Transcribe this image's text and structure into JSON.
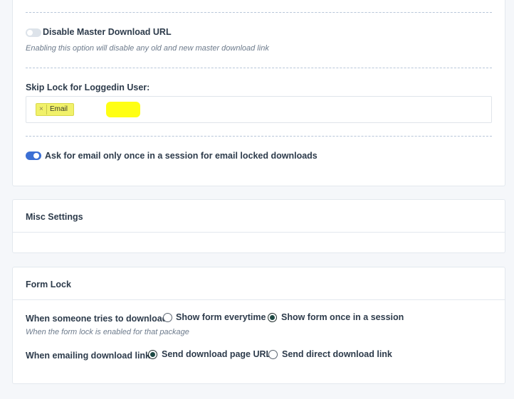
{
  "colors": {
    "accent": "#3b6fd4",
    "highlight": "#ffff14",
    "tag_bg": "#f1f16a",
    "radio_checked": "#1f4a44"
  },
  "top_card": {
    "disable_master": {
      "label": "Disable Master Download URL",
      "enabled": false,
      "hint": "Enabling this option will disable any old and new master download link"
    },
    "skip_lock": {
      "label": "Skip Lock for Loggedin User:",
      "tags": [
        {
          "remove_symbol": "×",
          "label": "Email"
        }
      ]
    },
    "ask_email_once": {
      "label": "Ask for email only once in a session for email locked downloads",
      "enabled": true
    }
  },
  "misc_card": {
    "title": "Misc Settings"
  },
  "form_lock_card": {
    "title": "Form Lock",
    "when_download": {
      "label": "When someone tries to download:",
      "options": [
        "Show form everytime",
        "Show form once in a session"
      ],
      "selected": "Show form once in a session",
      "hint": "When the form lock is enabled for that package"
    },
    "when_email": {
      "label": "When emailing download link:",
      "options": [
        "Send download page URL",
        "Send direct download link"
      ],
      "selected": "Send download page URL"
    }
  }
}
